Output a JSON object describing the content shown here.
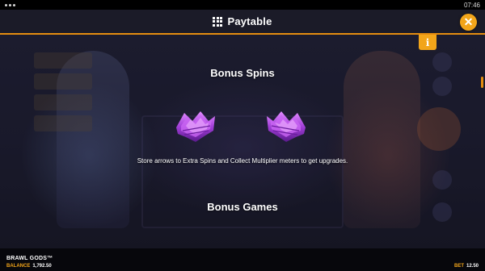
{
  "status_bar": {
    "time": "07:46"
  },
  "header": {
    "title": "Paytable",
    "menu_icon": "grid-icon",
    "close_icon": "close-icon",
    "accent_color": "#e58d10"
  },
  "info_button": {
    "label": "i"
  },
  "sections": [
    {
      "heading": "Bonus Spins",
      "description": "Store arrows to Extra Spins and Collect Multiplier meters to get upgrades.",
      "symbols": [
        "purple-arrow-symbol",
        "purple-arrow-symbol"
      ]
    },
    {
      "heading": "Bonus Games"
    }
  ],
  "footer": {
    "game_name": "BRAWL GODS™",
    "balance_label": "BALANCE",
    "balance_value": "1,792.50",
    "bet_label": "BET",
    "bet_value": "12.50"
  },
  "colors": {
    "orange": "#f2a51a",
    "purple": "#a23fd8",
    "background": "#1e1e33"
  }
}
